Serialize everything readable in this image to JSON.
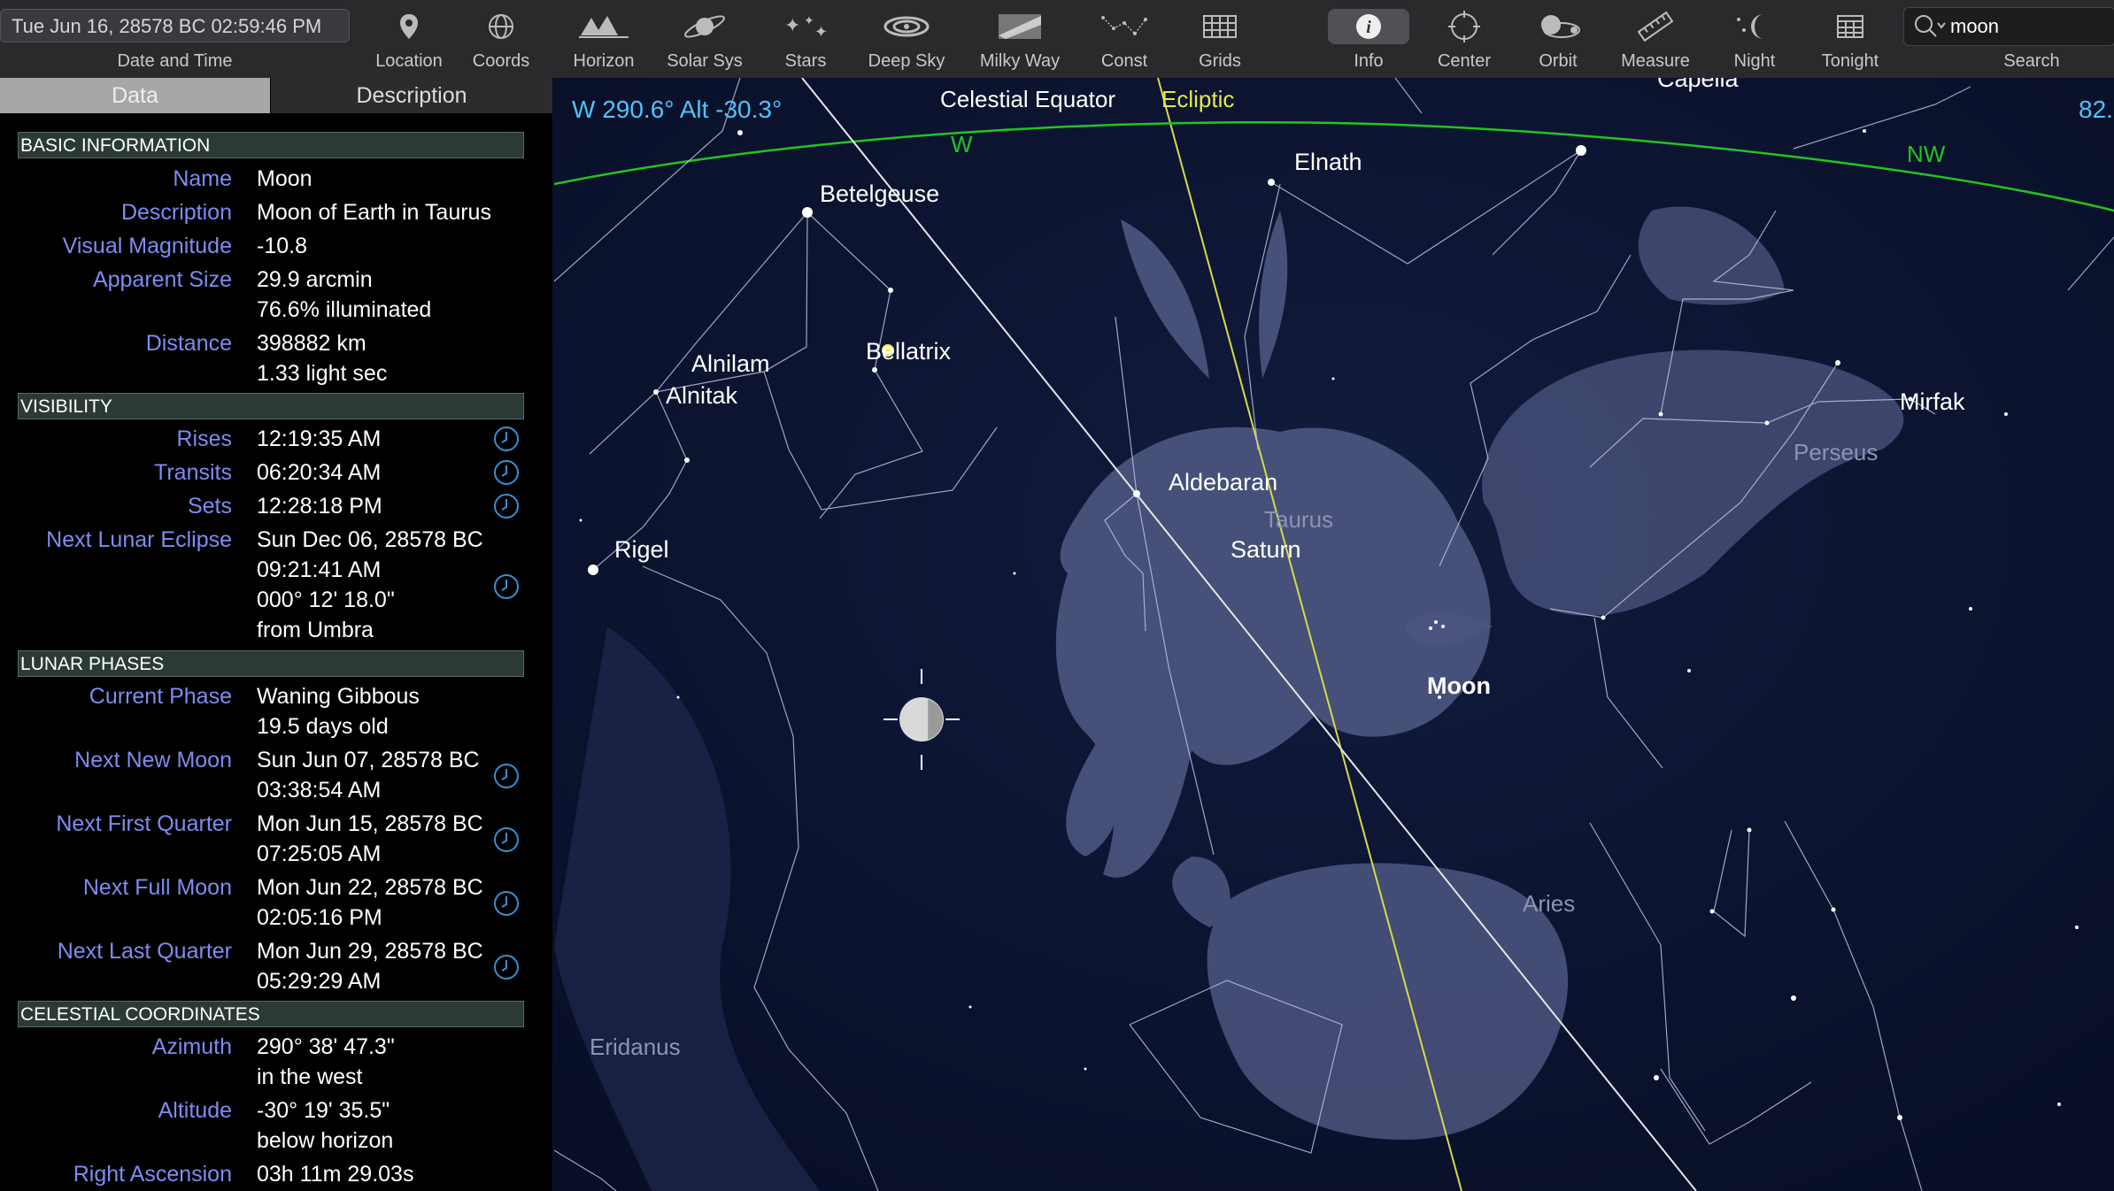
{
  "toolbar": {
    "datetime": "Tue Jun 16, 28578 BC 02:59:46 PM",
    "datetime_label": "Date and Time",
    "buttons": [
      "Location",
      "Coords",
      "Horizon",
      "Solar Sys",
      "Stars",
      "Deep Sky",
      "Milky Way",
      "Const",
      "Grids",
      "Info",
      "Center",
      "Orbit",
      "Measure",
      "Night",
      "Tonight"
    ],
    "search_value": "moon",
    "search_label": "Search"
  },
  "tabs": {
    "data": "Data",
    "description": "Description"
  },
  "sections": {
    "basic": "BASIC INFORMATION",
    "visibility": "VISIBILITY",
    "phases": "LUNAR PHASES",
    "coords": "CELESTIAL COORDINATES"
  },
  "basic": {
    "name_k": "Name",
    "name_v": "Moon",
    "desc_k": "Description",
    "desc_v": "Moon of Earth in Taurus",
    "mag_k": "Visual Magnitude",
    "mag_v": "-10.8",
    "size_k": "Apparent Size",
    "size_v1": "29.9 arcmin",
    "size_v2": "76.6% illuminated",
    "dist_k": "Distance",
    "dist_v1": "398882 km",
    "dist_v2": "1.33 light sec"
  },
  "visibility": {
    "rises_k": "Rises",
    "rises_v": "12:19:35 AM",
    "transits_k": "Transits",
    "transits_v": "06:20:34 AM",
    "sets_k": "Sets",
    "sets_v": "12:28:18 PM",
    "eclipse_k": "Next Lunar Eclipse",
    "eclipse_v1": "Sun Dec 06, 28578 BC",
    "eclipse_v2": "09:21:41 AM",
    "eclipse_v3": "000° 12' 18.0\"",
    "eclipse_v4": "from Umbra"
  },
  "phases": {
    "current_k": "Current Phase",
    "current_v1": "Waning Gibbous",
    "current_v2": "19.5 days old",
    "new_k": "Next New Moon",
    "new_v1": "Sun Jun 07, 28578 BC",
    "new_v2": "03:38:54 AM",
    "first_k": "Next First Quarter",
    "first_v1": "Mon Jun 15, 28578 BC",
    "first_v2": "07:25:05 AM",
    "full_k": "Next Full Moon",
    "full_v1": "Mon Jun 22, 28578 BC",
    "full_v2": "02:05:16 PM",
    "last_k": "Next Last Quarter",
    "last_v1": "Mon Jun 29, 28578 BC",
    "last_v2": "05:29:29 AM"
  },
  "coords": {
    "az_k": "Azimuth",
    "az_v1": "290° 38' 47.3\"",
    "az_v2": "in the west",
    "alt_k": "Altitude",
    "alt_v1": "-30° 19' 35.5\"",
    "alt_v2": "below horizon",
    "ra_k": "Right Ascension",
    "ra_v": "03h 11m 29.03s"
  },
  "sky": {
    "readout": "W 290.6° Alt -30.3°",
    "readout_right": "82.",
    "celestial_equator": "Celestial Equator",
    "ecliptic": "Ecliptic",
    "dir_w": "W",
    "dir_nw": "NW",
    "stars": {
      "betelgeuse": "Betelgeuse",
      "bellatrix": "Bellatrix",
      "alnilam": "Alnilam",
      "alnitak": "Alnitak",
      "rigel": "Rigel",
      "elnath": "Elnath",
      "capella": "Capella",
      "aldebaran": "Aldebaran",
      "mirfak": "Mirfak"
    },
    "planets": {
      "saturn": "Saturn",
      "moon": "Moon"
    },
    "constellations": {
      "taurus": "Taurus",
      "perseus": "Perseus",
      "aries": "Aries",
      "eridanus": "Eridanus"
    }
  },
  "colors": {
    "accent_label": "#7e8cf0",
    "equator_green": "#22c422",
    "ecliptic_yellow": "#e8e84a",
    "readout_blue": "#4fc3f7"
  }
}
